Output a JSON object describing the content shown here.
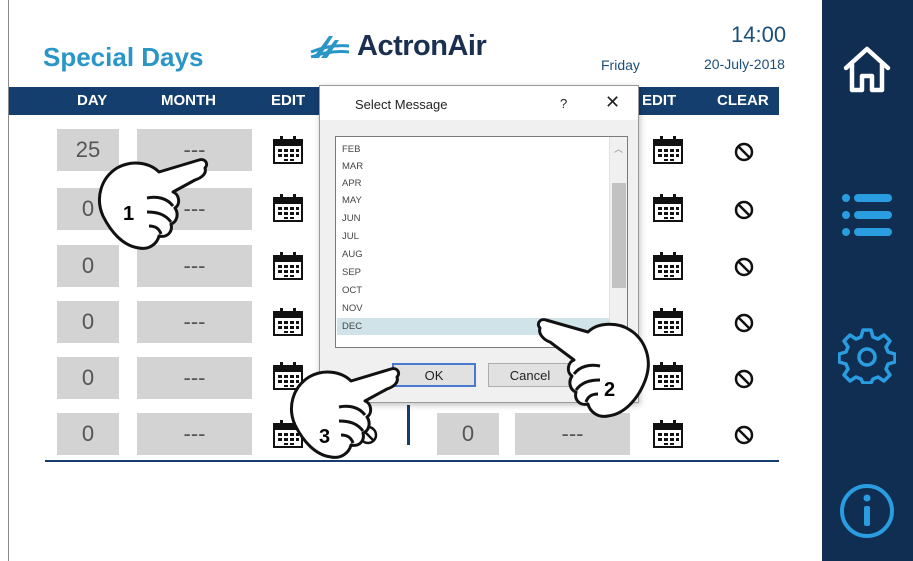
{
  "header": {
    "title": "Special Days",
    "logo_text": "ActronAir",
    "day_name": "Friday",
    "time": "14:00",
    "date": "20-July-2018"
  },
  "table": {
    "columns": [
      "DAY",
      "MONTH",
      "EDIT",
      "EDIT",
      "CLEAR"
    ],
    "left_rows": [
      {
        "day": "25",
        "month": "---"
      },
      {
        "day": "0",
        "month": "---"
      },
      {
        "day": "0",
        "month": "---"
      },
      {
        "day": "0",
        "month": "---"
      },
      {
        "day": "0",
        "month": "---"
      },
      {
        "day": "0",
        "month": "---"
      }
    ],
    "right_row_6": {
      "day": "0",
      "month": "---"
    }
  },
  "dialog": {
    "title": "Select Message",
    "help": "?",
    "close": "✕",
    "items": [
      "FEB",
      "MAR",
      "APR",
      "MAY",
      "JUN",
      "JUL",
      "AUG",
      "SEP",
      "OCT",
      "NOV",
      "DEC"
    ],
    "selected": "DEC",
    "ok_label": "OK",
    "cancel_label": "Cancel"
  },
  "annotations": [
    "1",
    "2",
    "3"
  ],
  "sidebar": {
    "items": [
      "home-icon",
      "menu-icon",
      "settings-icon",
      "info-icon"
    ]
  },
  "colors": {
    "accent": "#2a96c8",
    "header_bar": "#143e6e",
    "sidebar": "#0f2e52",
    "sidebar_icon": "#2a9ce0",
    "cell": "#d3d3d3"
  }
}
